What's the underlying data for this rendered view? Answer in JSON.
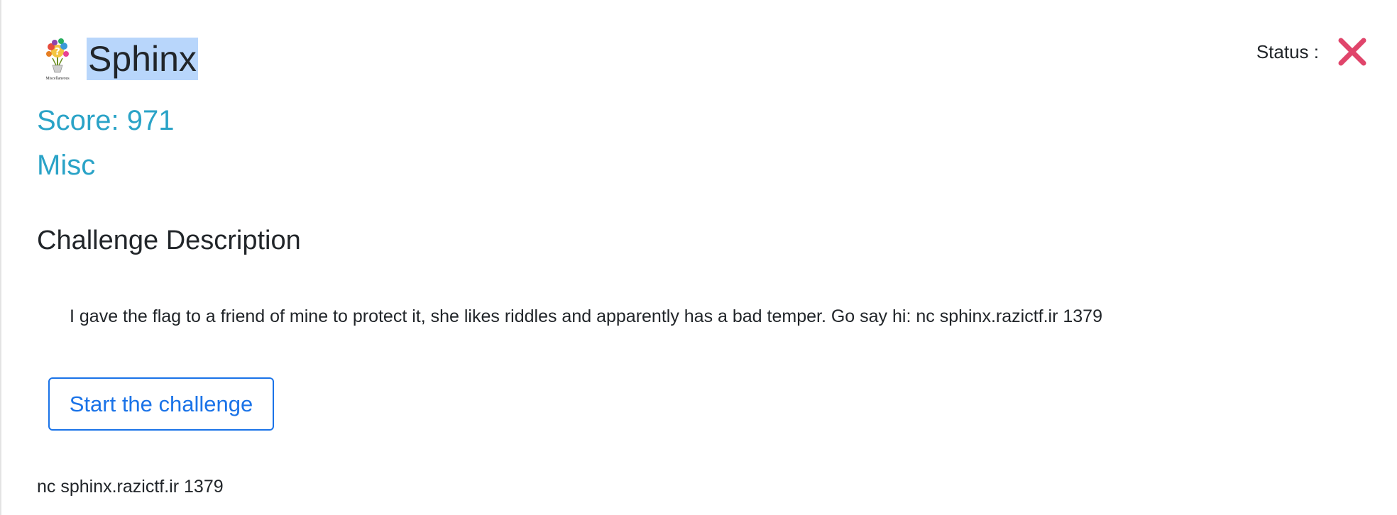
{
  "challenge": {
    "icon": "misc-category-icon",
    "icon_caption": "Miscellaneous",
    "title": "Sphinx",
    "score": "Score: 971",
    "category": "Misc"
  },
  "status": {
    "label": "Status :",
    "icon": "close-icon",
    "color": "#e0456b"
  },
  "description": {
    "heading": "Challenge Description",
    "text": "I gave the flag to a friend of mine to protect it, she likes riddles and apparently has a bad temper. Go say hi: nc sphinx.razictf.ir 1379"
  },
  "actions": {
    "start_label": "Start the challenge"
  },
  "connection": {
    "text": "nc sphinx.razictf.ir 1379"
  },
  "colors": {
    "accent": "#2aa3c7",
    "button": "#1a73e8",
    "selection": "#b8d6fb"
  }
}
